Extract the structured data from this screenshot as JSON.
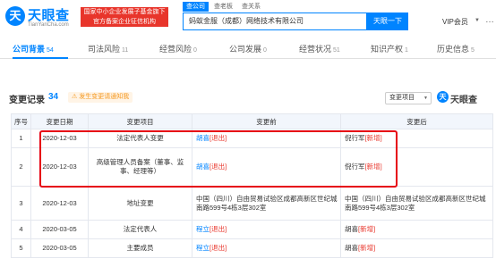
{
  "header": {
    "logo_mark": "天",
    "logo_name": "天眼查",
    "logo_domain": "TianYanCha.com",
    "slogan_line1": "国家中小企业发展子基金旗下",
    "slogan_line2": "官方备案企业征信机构",
    "search_tabs": [
      "查公司",
      "查老板",
      "查关系"
    ],
    "search_value": "蚂蚁金服（成都）网络技术有限公司",
    "search_button": "天眼一下",
    "vip_label": "VIP会员",
    "more_icon": "…"
  },
  "nav": {
    "tabs": [
      {
        "label": "公司背景",
        "count": "54"
      },
      {
        "label": "司法风险",
        "count": "11"
      },
      {
        "label": "经营风险",
        "count": "0"
      },
      {
        "label": "公司发展",
        "count": "0"
      },
      {
        "label": "经营状况",
        "count": "51"
      },
      {
        "label": "知识产权",
        "count": "1"
      },
      {
        "label": "历史信息",
        "count": "5"
      }
    ]
  },
  "section": {
    "title": "变更记录",
    "count": "34",
    "warning": "发生变更请通知我",
    "filter_label": "变更项目",
    "watermark": "天眼查"
  },
  "table": {
    "headers": [
      "序号",
      "变更日期",
      "变更项目",
      "变更前",
      "变更后"
    ],
    "rows": [
      {
        "no": "1",
        "date": "2020-12-03",
        "item": "法定代表人变更",
        "before_name": "胡喜",
        "before_tag": "[退出]",
        "after_name": "倪行军",
        "after_tag": "[新增]"
      },
      {
        "no": "2",
        "date": "2020-12-03",
        "item": "高级管理人员备案（董事、监事、经理等）",
        "before_name": "胡喜",
        "before_tag": "[退出]",
        "after_name": "倪行军",
        "after_tag": "[新增]"
      },
      {
        "no": "3",
        "date": "2020-12-03",
        "item": "地址变更",
        "before_text": "中国（四川）自由贸易试验区成都高新区世纪城南路599号4栋3层302室",
        "after_text": "中国（四川）自由贸易试验区成都高新区世纪城南路599号4栋3层302室"
      },
      {
        "no": "4",
        "date": "2020-03-05",
        "item": "法定代表人",
        "before_name": "程立",
        "before_tag": "[退出]",
        "after_name": "胡喜",
        "after_tag": "[新增]"
      },
      {
        "no": "5",
        "date": "2020-03-05",
        "item": "主要成员",
        "before_name": "程立",
        "before_tag": "[退出]",
        "after_name": "胡喜",
        "after_tag": "[新增]"
      }
    ]
  },
  "colors": {
    "accent": "#0084ff",
    "alert": "#e8352b",
    "highlight_box": "#e60012"
  }
}
